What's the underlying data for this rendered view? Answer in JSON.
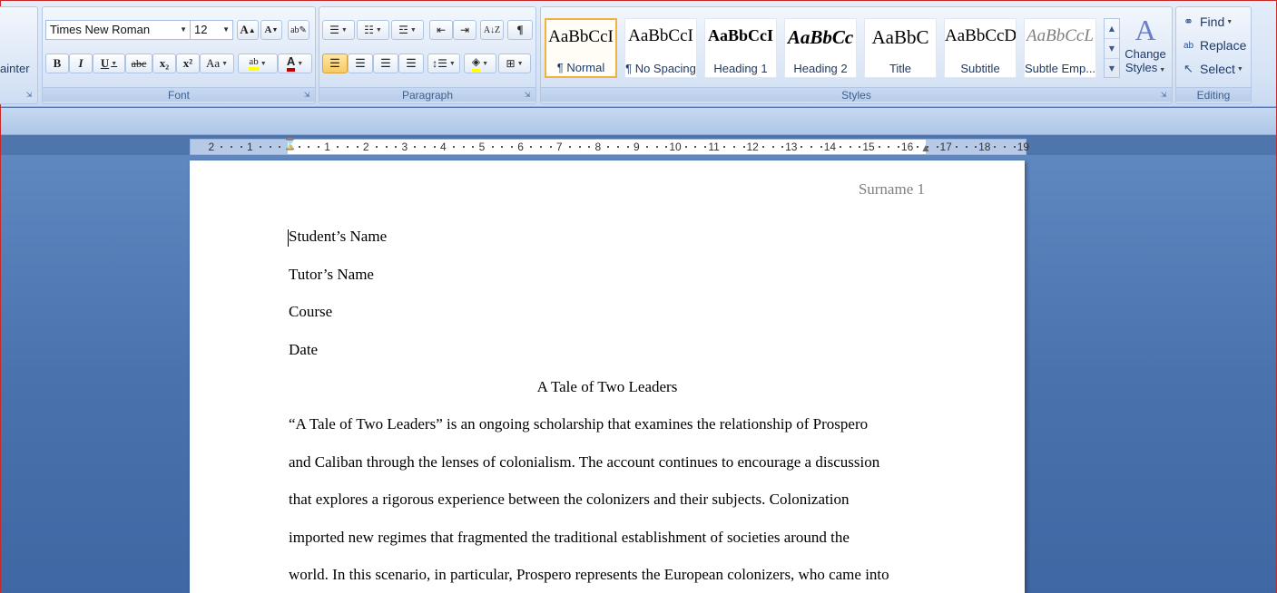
{
  "clipboard": {
    "partial_label": "ainter"
  },
  "font_group": {
    "label": "Font",
    "font_name": "Times New Roman",
    "font_size": "12",
    "grow_icon_text": "A",
    "shrink_icon_text": "A",
    "bold": "B",
    "italic": "I",
    "underline": "U",
    "strike": "abc",
    "subscript": "x₂",
    "superscript": "x²",
    "change_case": "Aa",
    "highlight": "ab",
    "font_color": "A"
  },
  "paragraph_group": {
    "label": "Paragraph",
    "show_marks": "¶"
  },
  "styles_group": {
    "label": "Styles",
    "styles": [
      {
        "sample": "AaBbCcI",
        "name": "¶ Normal",
        "selected": true
      },
      {
        "sample": "AaBbCcI",
        "name": "¶ No Spacing",
        "selected": false
      },
      {
        "sample": "AaBbCcI",
        "name": "Heading 1",
        "selected": false
      },
      {
        "sample": "AaBbCc",
        "name": "Heading 2",
        "selected": false
      },
      {
        "sample": "AaBbC",
        "name": "Title",
        "selected": false
      },
      {
        "sample": "AaBbCcD",
        "name": "Subtitle",
        "selected": false
      },
      {
        "sample": "AaBbCcL",
        "name": "Subtle Emp...",
        "selected": false
      }
    ],
    "change_styles_line1": "Change",
    "change_styles_line2": "Styles"
  },
  "editing_group": {
    "label": "Editing",
    "find": "Find",
    "replace": "Replace",
    "select": "Select"
  },
  "ruler": {
    "left_labels": [
      "2",
      "1"
    ],
    "right_labels": [
      "1",
      "2",
      "3",
      "4",
      "5",
      "6",
      "7",
      "8",
      "9",
      "10",
      "11",
      "12",
      "13",
      "14",
      "15",
      "16",
      "17",
      "18",
      "19"
    ]
  },
  "document": {
    "header": "Surname 1",
    "lines": [
      "Student’s Name",
      "Tutor’s Name",
      "Course",
      "Date"
    ],
    "title": "A Tale of Two Leaders",
    "body": [
      " “A Tale of Two Leaders” is an ongoing scholarship that examines the relationship of Prospero",
      "and Caliban through the lenses of colonialism. The account continues to encourage a discussion",
      "that explores a rigorous experience between the colonizers and their subjects. Colonization",
      "imported new regimes that fragmented the traditional establishment of societies around the",
      "world. In this scenario, in particular, Prospero represents the European colonizers, who came into"
    ]
  }
}
